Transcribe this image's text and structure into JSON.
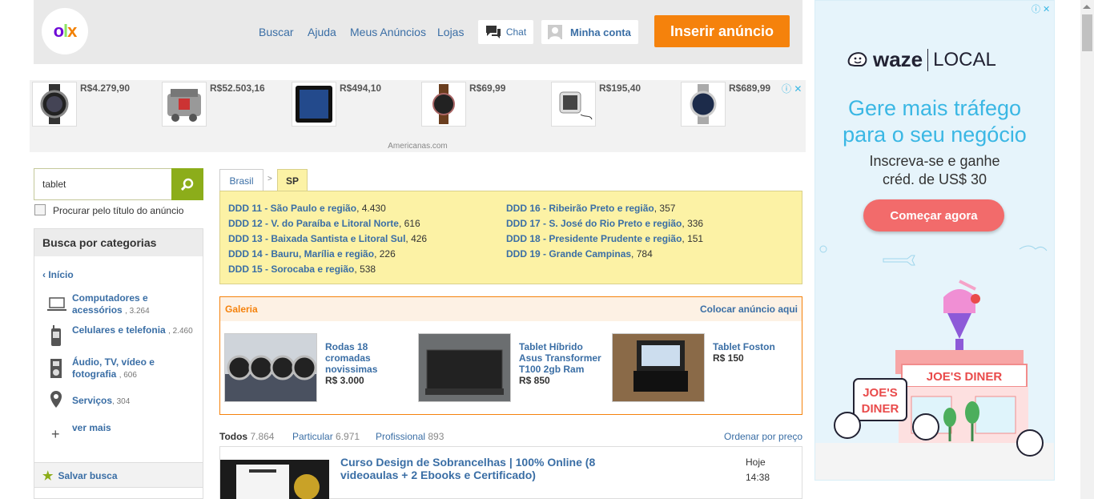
{
  "header": {
    "logo": {
      "o": "o",
      "l": "l",
      "x": "x"
    },
    "nav": [
      "Buscar",
      "Ajuda",
      "Meus Anúncios",
      "Lojas"
    ],
    "chat": "Chat",
    "account": "Minha conta",
    "insert": "Inserir anúncio"
  },
  "ad_strip": {
    "products": [
      {
        "price": "R$4.279,90",
        "icon": "watch-icon"
      },
      {
        "price": "R$52.503,16",
        "icon": "engine-icon"
      },
      {
        "price": "R$494,10",
        "icon": "tablet-icon"
      },
      {
        "price": "R$69,99",
        "icon": "watch-icon"
      },
      {
        "price": "R$195,40",
        "icon": "smartwatch-icon"
      },
      {
        "price": "R$689,99",
        "icon": "watch-icon"
      }
    ],
    "source": "Americanas.com"
  },
  "right_ad": {
    "brand": "waze",
    "brand_suffix": "LOCAL",
    "headline_1": "Gere mais tráfego",
    "headline_2": "para o seu negócio",
    "sub_1": "Inscreva-se e ganhe",
    "sub_2": "créd. de US$ 30",
    "cta": "Começar agora",
    "sign": "JOE'S DINER",
    "bubble_1": "JOE'S",
    "bubble_2": "DINER",
    "accent": "#3ab7e4",
    "cta_color": "#f26b6b"
  },
  "search": {
    "value": "tablet",
    "title_only": "Procurar pelo título do anúncio"
  },
  "sidebar": {
    "heading": "Busca por categorias",
    "home": "Início",
    "categories": [
      {
        "label_1": "Computadores e",
        "label_2": "acessórios",
        "count": "3.264",
        "icon": "laptop-icon"
      },
      {
        "label_1": "Celulares e telefonia",
        "count": "2.460",
        "icon": "phone-icon"
      },
      {
        "label_1": "Áudio, TV, vídeo e",
        "label_2": "fotografia",
        "count": "606",
        "icon": "camera-icon"
      },
      {
        "label_1": "Serviços",
        "count": "304",
        "icon": "pin-icon"
      },
      {
        "label_1": "ver mais",
        "icon": "plus-icon"
      }
    ],
    "save_search": "Salvar busca"
  },
  "breadcrumb": {
    "country": "Brasil",
    "sep": ">",
    "state": "SP"
  },
  "regions_left": [
    {
      "name": "DDD 11 - São Paulo e região",
      "count": "4.430"
    },
    {
      "name": "DDD 12 - V. do Paraíba e Litoral Norte",
      "count": "616"
    },
    {
      "name": "DDD 13 - Baixada Santista e Litoral Sul",
      "count": "426"
    },
    {
      "name": "DDD 14 - Bauru, Marília e região",
      "count": "226"
    },
    {
      "name": "DDD 15 - Sorocaba e região",
      "count": "538"
    }
  ],
  "regions_right": [
    {
      "name": "DDD 16 - Ribeirão Preto e região",
      "count": "357"
    },
    {
      "name": "DDD 17 - S. José do Rio Preto e região",
      "count": "336"
    },
    {
      "name": "DDD 18 - Presidente Prudente e região",
      "count": "151"
    },
    {
      "name": "DDD 19 - Grande Campinas",
      "count": "784"
    }
  ],
  "gallery": {
    "title": "Galeria",
    "cta": "Colocar anúncio aqui",
    "items": [
      {
        "t1": "Rodas 18",
        "t2": "cromadas",
        "t3": "novissimas",
        "price": "R$ 3.000"
      },
      {
        "t1": "Tablet Híbrido",
        "t2": "Asus Transformer",
        "t3": "T100 2gb Ram",
        "price": "R$ 850"
      },
      {
        "t1": "Tablet Foston",
        "price": "R$ 150"
      }
    ]
  },
  "filters": {
    "all": "Todos",
    "all_count": "7.864",
    "private": "Particular",
    "private_count": "6.971",
    "pro": "Profissional",
    "pro_count": "893",
    "sort": "Ordenar por preço"
  },
  "listing": {
    "title_1": "Curso Design de Sobrancelhas | 100% Online (8",
    "title_2": "videoaulas + 2 Ebooks e Certificado)",
    "date": "Hoje",
    "time": "14:38"
  }
}
